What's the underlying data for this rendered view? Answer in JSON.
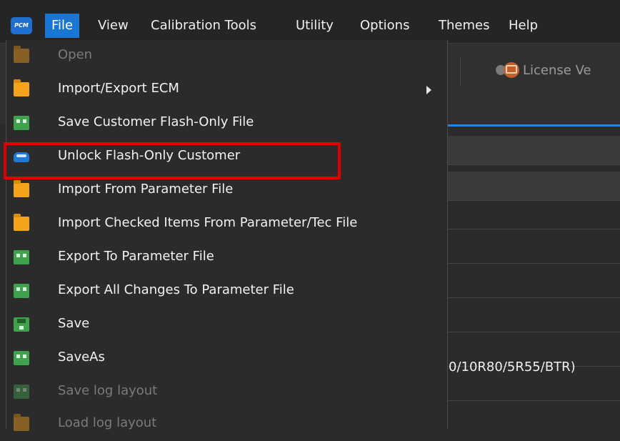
{
  "app": {
    "logo_text": "PCM"
  },
  "menubar": {
    "items": [
      {
        "label": "File",
        "active": true
      },
      {
        "label": "View"
      },
      {
        "label": "Calibration Tools"
      },
      {
        "label": "Utility"
      },
      {
        "label": "Options"
      },
      {
        "label": "Themes"
      },
      {
        "label": "Help"
      }
    ]
  },
  "toolbar": {
    "license_label": "License Ve"
  },
  "background": {
    "partial_text": "0/10R80/5R55/BTR)"
  },
  "file_menu": {
    "items": [
      {
        "label": "Open",
        "icon": "folder-icon",
        "enabled": false
      },
      {
        "label": "Import/Export ECM",
        "icon": "folder-icon",
        "enabled": true,
        "has_submenu": true
      },
      {
        "label": "Save Customer Flash-Only File",
        "icon": "package-icon",
        "enabled": true,
        "highlighted": true
      },
      {
        "label": "Unlock Flash-Only Customer",
        "icon": "car-icon",
        "enabled": true
      },
      {
        "label": "Import From Parameter File",
        "icon": "folder-icon",
        "enabled": true
      },
      {
        "label": "Import Checked Items From Parameter/Tec File",
        "icon": "folder-icon",
        "enabled": true
      },
      {
        "label": "Export To Parameter File",
        "icon": "package-icon",
        "enabled": true
      },
      {
        "label": "Export All Changes To Parameter File",
        "icon": "package-icon",
        "enabled": true
      },
      {
        "label": "Save",
        "icon": "floppy-icon",
        "enabled": true
      },
      {
        "label": "SaveAs",
        "icon": "package-icon",
        "enabled": true
      },
      {
        "label": "Save log layout",
        "icon": "package-icon",
        "enabled": false
      },
      {
        "label": "Load log layout",
        "icon": "folder-icon",
        "enabled": false
      }
    ]
  },
  "colors": {
    "accent": "#1976d2",
    "highlight_box": "#e00000",
    "folder": "#f5a31a",
    "package": "#3fa34d",
    "car": "#1f7ad6"
  }
}
